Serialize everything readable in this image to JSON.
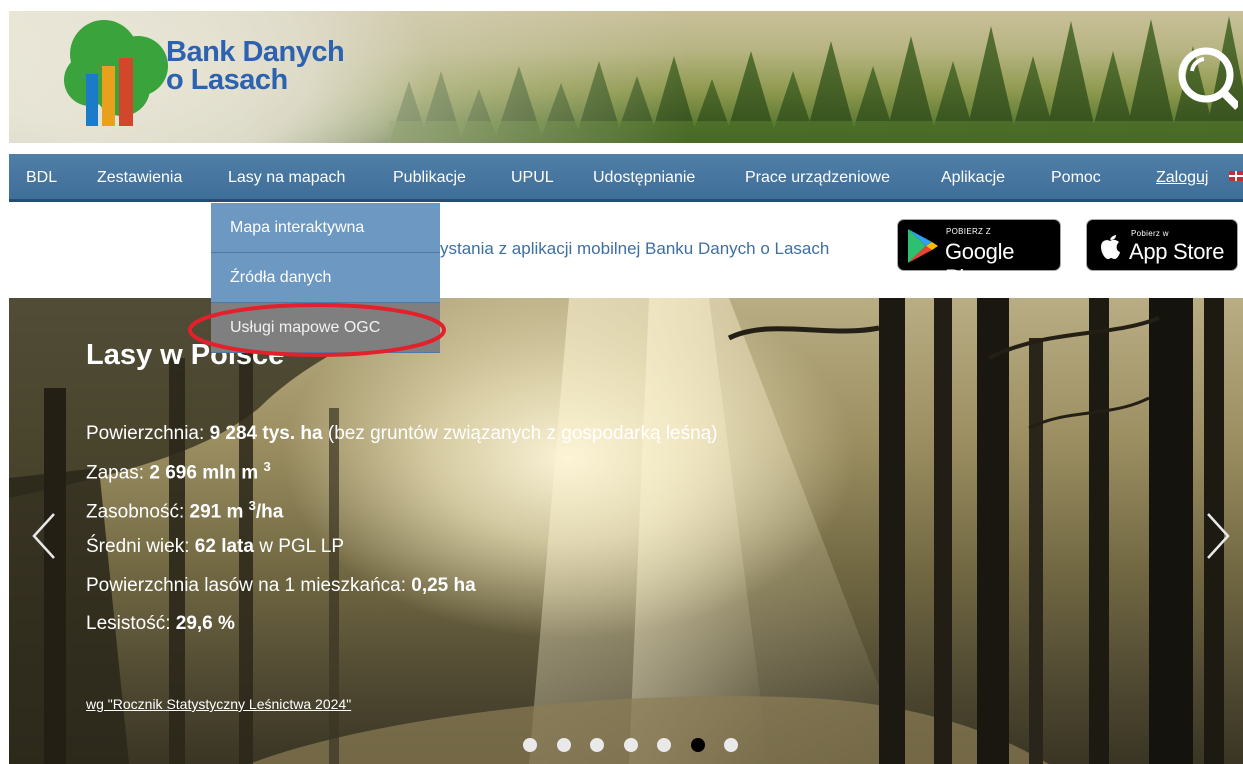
{
  "header": {
    "logo_line1": "Bank Danych",
    "logo_line2": "o Lasach"
  },
  "nav": {
    "items": [
      "BDL",
      "Zestawienia",
      "Lasy na mapach",
      "Publikacje",
      "UPUL",
      "Udostępnianie",
      "Prace urządzeniowe",
      "Aplikacje",
      "Pomoc"
    ],
    "login": "Zaloguj"
  },
  "dropdown": {
    "items": [
      "Mapa interaktywna",
      "Źródła danych",
      "Usługi mapowe OGC"
    ],
    "active_index": 2
  },
  "info": {
    "text": "ystania z aplikacji mobilnej Banku Danych o Lasach"
  },
  "stores": {
    "google_small": "POBIERZ Z",
    "google_big": "Google Play",
    "apple_small": "Pobierz w",
    "apple_big": "App Store"
  },
  "hero": {
    "title": "Lasy w Polsce",
    "stats": {
      "area_label": "Powierzchnia: ",
      "area_value": "9 284 tys. ha",
      "area_note": " (bez gruntów związanych z gospodarką leśną)",
      "stock_label": "Zapas: ",
      "stock_value": "2 696 mln m ",
      "stock_sup": "3",
      "density_label": "Zasobność: ",
      "density_value": "291 m ",
      "density_sup": "3",
      "density_unit": "/ha",
      "age_label": "Średni wiek: ",
      "age_value": "62 lata",
      "age_note": " w PGL LP",
      "per_capita_label": "Powierzchnia lasów na 1 mieszkańca: ",
      "per_capita_value": "0,25 ha",
      "cover_label": "Lesistość: ",
      "cover_value": "29,6 %"
    },
    "source": "wg \"Rocznik Statystyczny Leśnictwa 2024\"",
    "slides_count": 7,
    "active_slide": 5
  },
  "colors": {
    "nav_bg": "#4a79a3",
    "dropdown_bg": "#6c98c1",
    "dropdown_active": "#7f7f7f",
    "highlight": "#e3202b",
    "link_blue": "#3e6fa3",
    "logo_blue": "#2d62b0"
  }
}
